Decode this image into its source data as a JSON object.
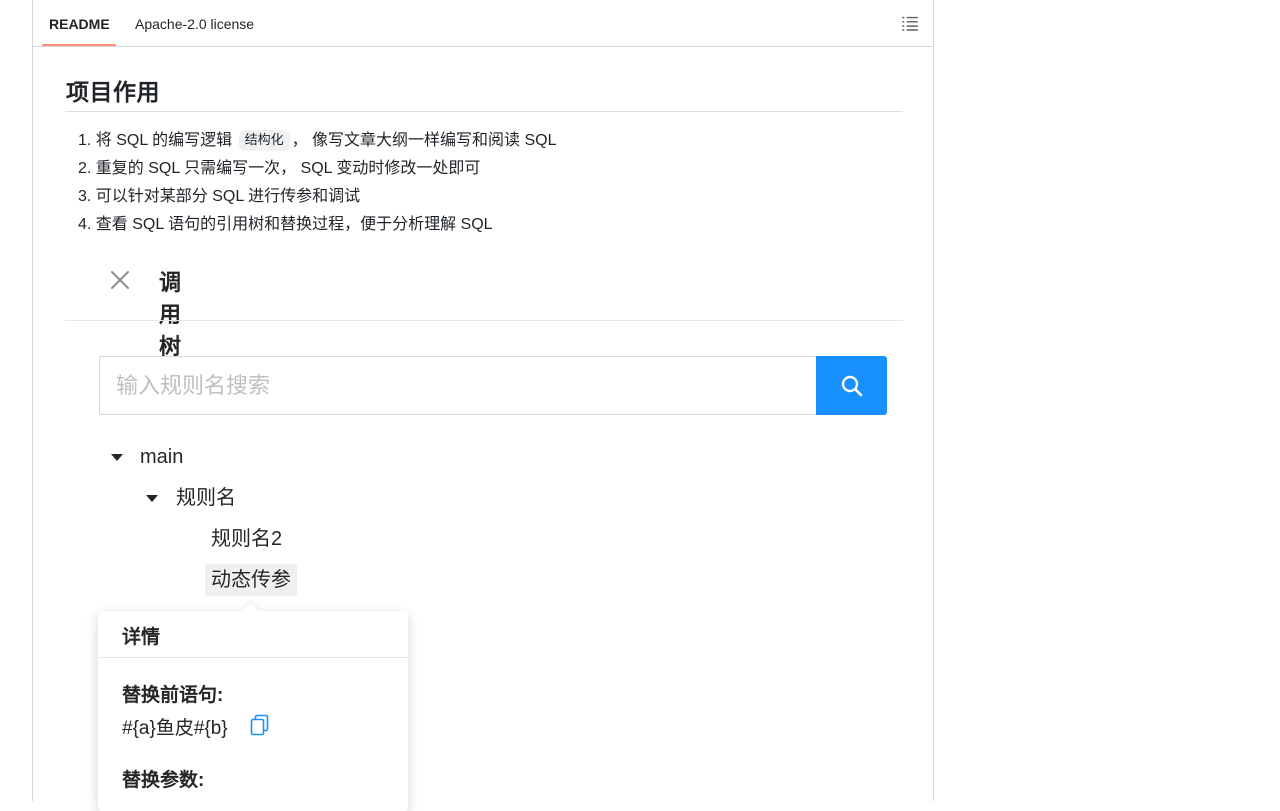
{
  "tabs": [
    {
      "label": "README",
      "active": true
    },
    {
      "label": "Apache-2.0 license",
      "active": false
    }
  ],
  "toc_icon": "list-unordered-icon",
  "section": {
    "heading": "项目作用",
    "items": [
      {
        "before": "将 SQL 的编写逻辑",
        "code": "结构化",
        "after": "， 像写文章大纲一样编写和阅读 SQL"
      },
      {
        "text": "重复的 SQL 只需编写一次， SQL 变动时修改一处即可"
      },
      {
        "text": "可以针对某部分 SQL 进行传参和调试"
      },
      {
        "text": "查看 SQL 语句的引用树和替换过程，便于分析理解 SQL"
      }
    ]
  },
  "panel": {
    "title": "调用树",
    "close_icon": "close-icon",
    "search": {
      "placeholder": "输入规则名搜索",
      "value": "",
      "button_icon": "search-icon",
      "button_color": "#1890ff"
    },
    "tree": {
      "root": "main",
      "child": "规则名",
      "leaves": [
        "规则名2",
        "动态传参"
      ],
      "selected": "动态传参"
    },
    "popover": {
      "title": "详情",
      "label_before": "替换前语句:",
      "value_before": "#{a}鱼皮#{b}",
      "copy_icon": "copy-icon",
      "label_params": "替换参数:"
    }
  },
  "colors": {
    "accent_underline": "#fd8c73",
    "primary": "#1890ff",
    "border": "#d0d7de"
  }
}
